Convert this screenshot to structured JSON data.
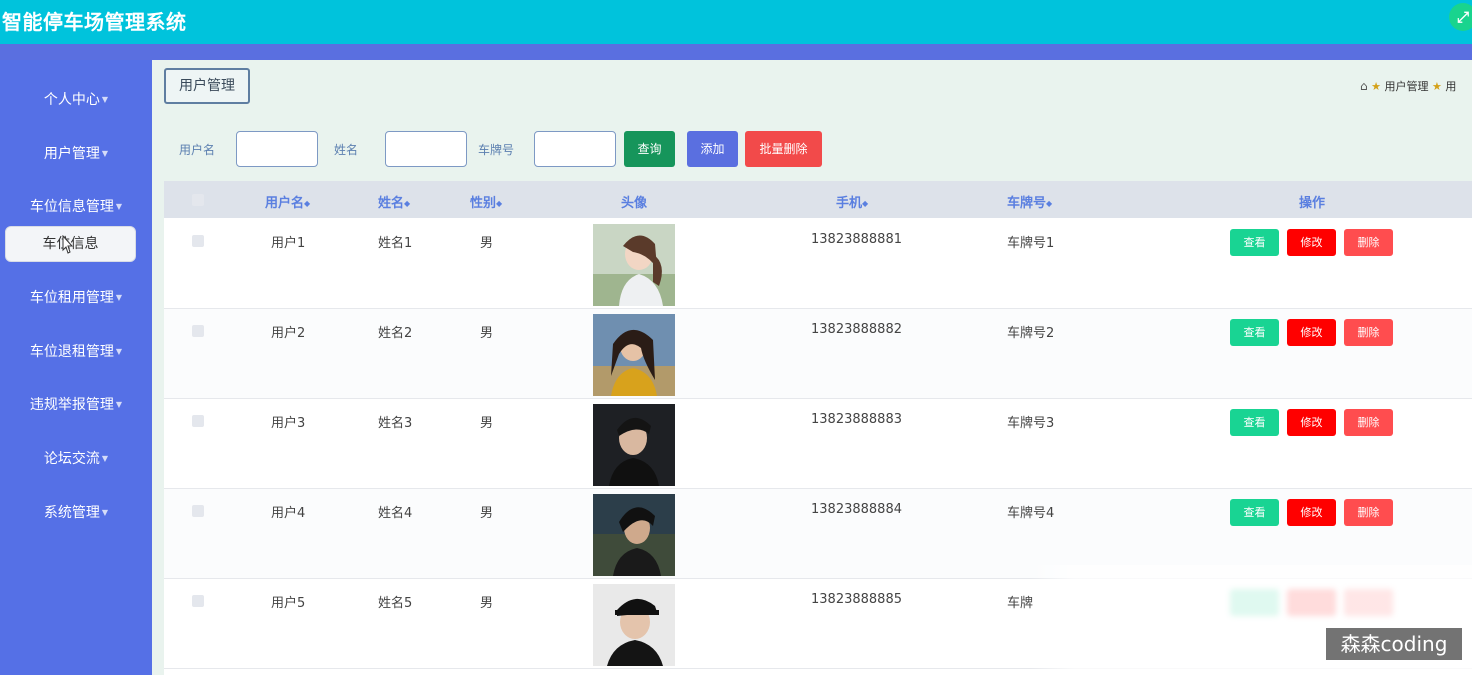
{
  "app": {
    "title": "智能停车场管理系统",
    "fullscreen_icon": "⤢"
  },
  "sidebar": {
    "items": [
      {
        "label": "个人中心",
        "name": "sidebar-item-personal-center"
      },
      {
        "label": "用户管理",
        "name": "sidebar-item-user-management"
      },
      {
        "label": "车位信息管理",
        "name": "sidebar-item-parking-info-management"
      },
      {
        "label": "车位租用管理",
        "name": "sidebar-item-parking-rental-management"
      },
      {
        "label": "车位退租管理",
        "name": "sidebar-item-parking-return-management"
      },
      {
        "label": "违规举报管理",
        "name": "sidebar-item-violation-report-management"
      },
      {
        "label": "论坛交流",
        "name": "sidebar-item-forum"
      },
      {
        "label": "系统管理",
        "name": "sidebar-item-system-management"
      }
    ],
    "submenu_item": "车位信息"
  },
  "tab": {
    "label": "用户管理"
  },
  "breadcrumb": {
    "item1": "用户管理",
    "item2": "用"
  },
  "search": {
    "username_label": "用户名",
    "name_label": "姓名",
    "plate_label": "车牌号",
    "query_button": "查询",
    "add_button": "添加",
    "bulk_delete_button": "批量删除"
  },
  "table": {
    "headers": {
      "username": "用户名",
      "name": "姓名",
      "gender": "性别",
      "avatar": "头像",
      "phone": "手机",
      "plate": "车牌号",
      "actions": "操作"
    },
    "sort_icon": "◆",
    "rows": [
      {
        "username": "用户1",
        "name": "姓名1",
        "gender": "男",
        "phone": "13823888881",
        "plate": "车牌号1"
      },
      {
        "username": "用户2",
        "name": "姓名2",
        "gender": "男",
        "phone": "13823888882",
        "plate": "车牌号2"
      },
      {
        "username": "用户3",
        "name": "姓名3",
        "gender": "男",
        "phone": "13823888883",
        "plate": "车牌号3"
      },
      {
        "username": "用户4",
        "name": "姓名4",
        "gender": "男",
        "phone": "13823888884",
        "plate": "车牌号4"
      },
      {
        "username": "用户5",
        "name": "姓名5",
        "gender": "男",
        "phone": "13823888885",
        "plate": "车牌"
      }
    ],
    "actions": {
      "view": "查看",
      "edit": "修改",
      "delete": "删除"
    }
  },
  "watermark": "森森coding",
  "colors": {
    "topbar": "#00c3dc",
    "sidebar": "#5570e6",
    "query_button": "#16955b",
    "add_button": "#5a6fe0",
    "bulk_delete_button": "#f24a4a",
    "view_button": "#19d493",
    "edit_button": "#ff0000",
    "delete_button": "#ff4d4f"
  }
}
